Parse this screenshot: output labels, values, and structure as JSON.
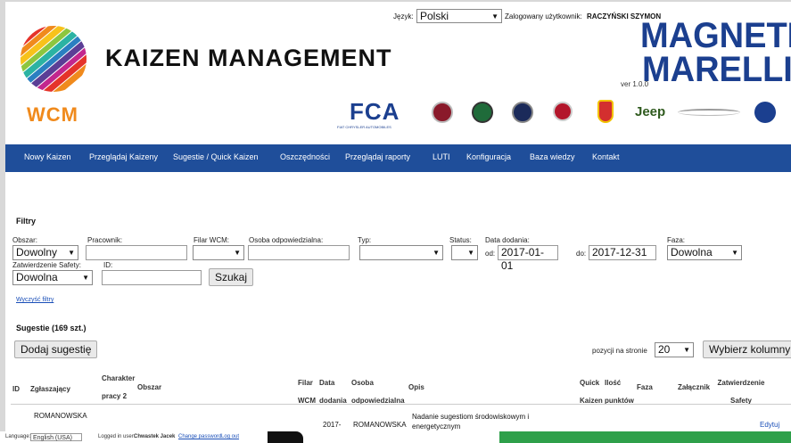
{
  "header": {
    "language_label": "Język:",
    "language_value": "Polski",
    "logged_user_label": "Zalogowany użytkownik:",
    "logged_user_name": "RACZYŃSKI SZYMON",
    "app_title": "KAIZEN MANAGEMENT",
    "wcm_text": "WCM",
    "brand_line1": "MAGNETI",
    "brand_line2": "MARELLI",
    "version": "ver 1.0.0",
    "partners": {
      "fca": "FCA",
      "fca_sub": "FIAT CHRYSLER AUTOMOBILES",
      "jeep": "Jeep"
    }
  },
  "nav": {
    "items": [
      "Nowy Kaizen",
      "Przeglądaj Kaizeny",
      "Sugestie / Quick Kaizen",
      "Oszczędności",
      "Przeglądaj raporty",
      "LUTI",
      "Konfiguracja",
      "Baza wiedzy",
      "Kontakt"
    ]
  },
  "filters": {
    "title": "Filtry",
    "obszar_label": "Obszar:",
    "obszar_value": "Dowolny",
    "pracownik_label": "Pracownik:",
    "filar_label": "Filar WCM:",
    "osoba_label": "Osoba odpowiedzialna:",
    "typ_label": "Typ:",
    "status_label": "Status:",
    "data_label": "Data dodania:",
    "od_label": "od:",
    "od_value": "2017-01-01",
    "do_label": "do:",
    "do_value": "2017-12-31",
    "faza_label": "Faza:",
    "faza_value": "Dowolna",
    "safety_label": "Zatwierdzenie Safety:",
    "safety_value": "Dowolna",
    "id_label": "ID:",
    "search_button": "Szukaj",
    "clear_link": "Wyczyść filtry"
  },
  "list": {
    "title": "Sugestie (169 szt.)",
    "add_button": "Dodaj sugestię",
    "per_page_label": "pozycji na stronie",
    "per_page_value": "20",
    "columns_button": "Wybierz kolumny",
    "headers": {
      "id": "ID",
      "zglaszajacy": "Zgłaszający",
      "charakter": "Charakter",
      "pracy": "pracy 2",
      "obszar": "Obszar",
      "filar_wcm": "Filar WCM",
      "data_dodania": "Data dodania",
      "osoba": "Osoba odpowiedzialna",
      "opis": "Opis",
      "quick_kaizen": "Quick Kaizen",
      "ilosc_punktow": "Ilość punktów",
      "faza": "Faza",
      "zalacznik": "Załącznik",
      "zatwierdzenie_safety": "Zatwierdzenie Safety"
    },
    "rows": [
      {
        "zglaszajacy": "ROMANOWSKA",
        "data": "2017-",
        "osoba": "ROMANOWSKA",
        "opis": "Nadanie sugestiom środowiskowym i energetycznym",
        "action": "Edytuj"
      }
    ]
  },
  "footer": {
    "language_label": "Language:",
    "language_value": "English (USA)",
    "logged_in_label": "Logged in user:",
    "logged_in_user": "Chwastek Jacek",
    "change_password": "Change password",
    "logout": "Log out"
  },
  "colors": {
    "nav_bg": "#1f4e9a",
    "brand_blue": "#1b3f8f",
    "wcm_orange": "#f08a1c",
    "page_bg": "#ffffff"
  }
}
